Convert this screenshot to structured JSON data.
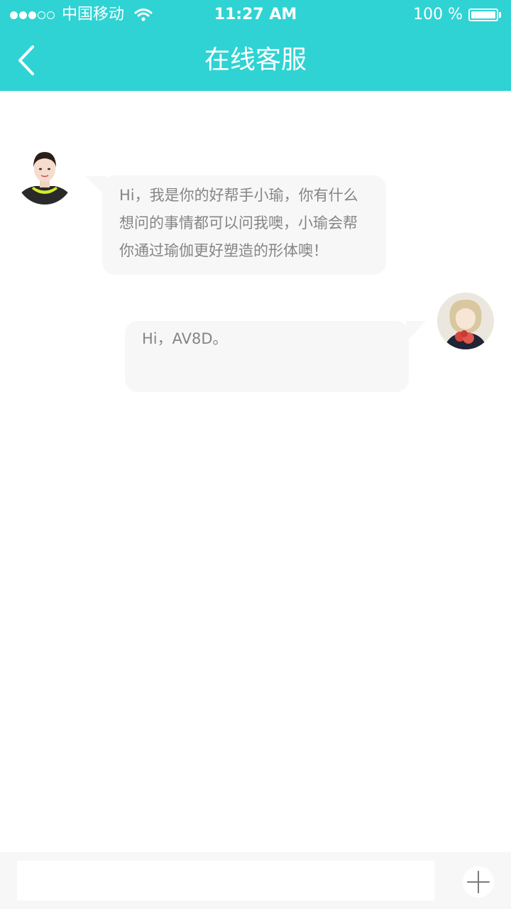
{
  "status_bar": {
    "carrier": "中国移动",
    "time": "11:27 AM",
    "battery": "100 %",
    "signal_bars_filled": 3,
    "signal_bars_total": 5
  },
  "nav": {
    "title": "在线客服",
    "back_icon": "chevron-left-icon"
  },
  "messages": [
    {
      "sender": "agent",
      "text": "Hi，我是你的好帮手小瑜，你有什么想问的事情都可以问我噢，小瑜会帮你通过瑜伽更好塑造的形体噢！"
    },
    {
      "sender": "user",
      "text": "Hi，AV8D。"
    }
  ],
  "input": {
    "value": "",
    "placeholder": ""
  },
  "colors": {
    "accent": "#2fd3d3",
    "bubble": "#f7f7f7",
    "text": "#858585"
  }
}
